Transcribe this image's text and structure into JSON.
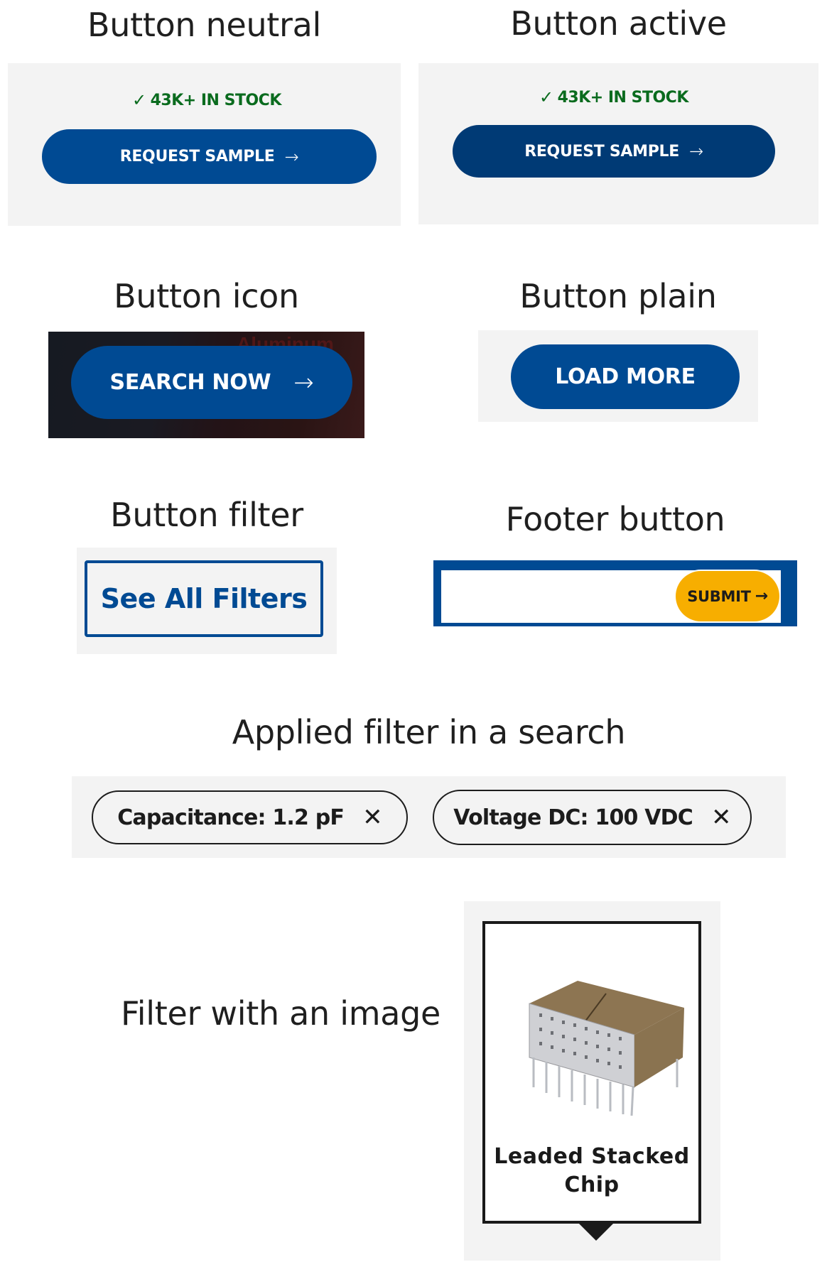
{
  "sections": {
    "neutral": {
      "heading": "Button neutral",
      "stock_text": "43K+ IN STOCK",
      "button_label": "REQUEST SAMPLE",
      "button_icon": "arrow-right-icon",
      "button_color": "#004a93"
    },
    "active": {
      "heading": "Button active",
      "stock_text": "43K+ IN STOCK",
      "button_label": "REQUEST SAMPLE",
      "button_icon": "arrow-right-icon",
      "button_color": "#003a75"
    },
    "icon": {
      "heading": "Button icon",
      "button_label": "SEARCH NOW",
      "button_icon": "arrow-right-icon",
      "background_text": "Aluminum"
    },
    "plain": {
      "heading": "Button plain",
      "button_label": "LOAD MORE"
    },
    "filter": {
      "heading": "Button filter",
      "button_label": "See All Filters"
    },
    "footer": {
      "heading": "Footer button",
      "input_value": "",
      "button_label": "SUBMIT",
      "button_icon": "arrow-right-icon",
      "button_color": "#f7ae00"
    },
    "applied": {
      "heading": "Applied filter in a search",
      "chips": [
        {
          "label": "Capacitance: 1.2 pF",
          "remove_icon": "close-icon"
        },
        {
          "label": "Voltage DC: 100 VDC",
          "remove_icon": "close-icon"
        }
      ]
    },
    "image_filter": {
      "heading": "Filter with an image",
      "card_label_line1": "Leaded Stacked",
      "card_label_line2": "Chip"
    }
  },
  "glyphs": {
    "arrow": "→",
    "check": "✓",
    "close": "✕"
  },
  "colors": {
    "brand_blue": "#004a93",
    "active_blue": "#003a75",
    "stock_green": "#0a6b1e",
    "submit_yellow": "#f7ae00",
    "panel_gray": "#f3f3f3"
  }
}
